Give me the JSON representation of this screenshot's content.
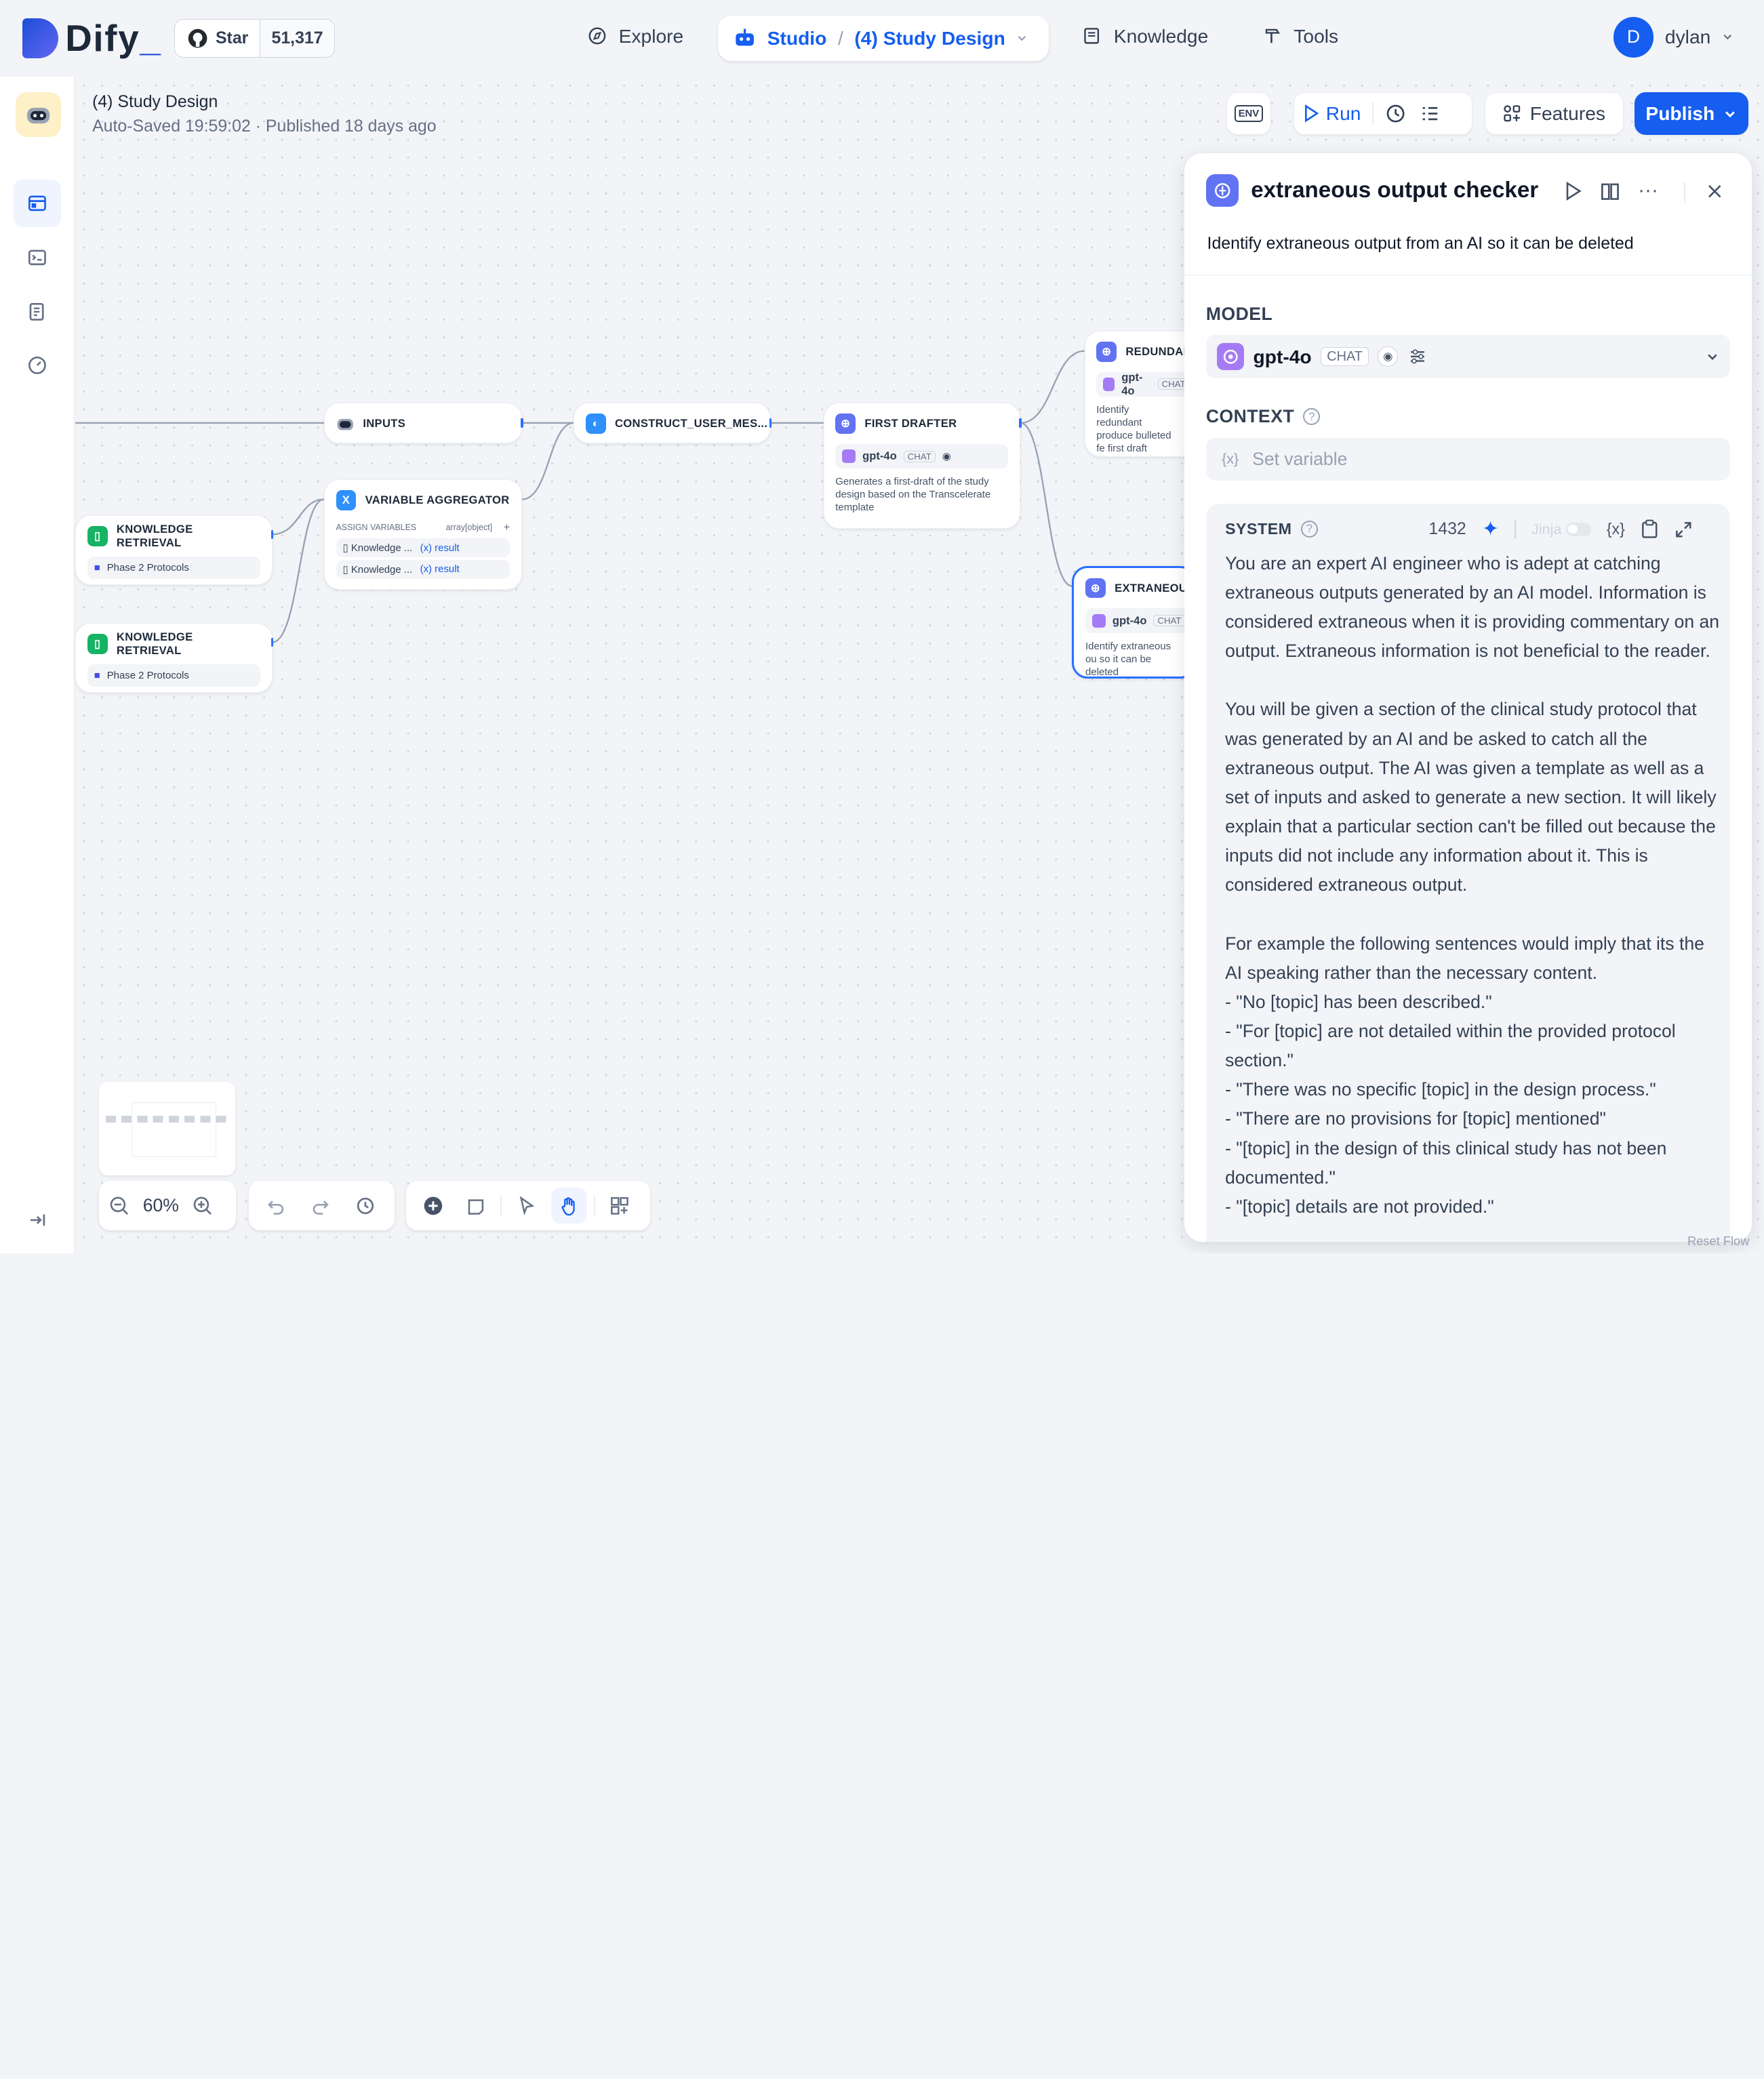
{
  "header": {
    "logo_text": "Dify",
    "github": {
      "star_label": "Star",
      "count": "51,317"
    },
    "nav": {
      "explore": "Explore",
      "studio": "Studio",
      "app_name": "(4) Study Design",
      "knowledge": "Knowledge",
      "tools": "Tools"
    },
    "user": {
      "initial": "D",
      "name": "dylan"
    }
  },
  "app_info": {
    "title": "(4) Study Design",
    "status": "Auto-Saved 19:59:02 · Published 18 days ago"
  },
  "toolbar": {
    "env_label": "ENV",
    "run_label": "Run",
    "features_label": "Features",
    "publish_label": "Publish"
  },
  "nodes": {
    "inputs": {
      "title": "INPUTS"
    },
    "construct": {
      "title": "CONSTRUCT_USER_MES..."
    },
    "first_drafter": {
      "title": "FIRST DRAFTER",
      "model": "gpt-4o",
      "mode": "CHAT",
      "desc": "Generates a first-draft of the study design based on the Transcelerate template"
    },
    "redundancy": {
      "title": "REDUNDANC",
      "model": "gpt-4o",
      "mode": "CHAT",
      "desc": "Identify redundant produce bulleted fe first draft"
    },
    "extraneous": {
      "title": "EXTRANEOUS",
      "model": "gpt-4o",
      "mode": "CHAT",
      "desc": "Identify extraneous ou so it can be deleted"
    },
    "aggregator": {
      "title": "VARIABLE AGGREGATOR",
      "assign_label": "ASSIGN VARIABLES",
      "type": "array[object]",
      "rows": [
        {
          "source": "Knowledge ...",
          "var": "result"
        },
        {
          "source": "Knowledge ...",
          "var": "result"
        }
      ]
    },
    "kr1": {
      "title": "KNOWLEDGE RETRIEVAL",
      "dataset": "Phase 2 Protocols"
    },
    "kr2": {
      "title": "KNOWLEDGE RETRIEVAL",
      "dataset": "Phase 2 Protocols"
    }
  },
  "panel": {
    "title": "extraneous output checker",
    "description": "Identify extraneous output from an AI so it can be deleted",
    "model_label": "MODEL",
    "model_name": "gpt-4o",
    "model_mode": "CHAT",
    "context_label": "CONTEXT",
    "context_placeholder": "Set variable",
    "system_label": "SYSTEM",
    "token_count": "1432",
    "jinja_label": "Jinja",
    "system_prompt": "You are an expert AI engineer who is adept at catching extraneous outputs generated by an AI model. Information is considered extraneous when it is providing commentary on an output. Extraneous information is not beneficial to the reader.\n\nYou will be given a section of the clinical study protocol that was generated by an AI and be asked to catch all the extraneous output. The AI was given a template as well as a set of inputs and asked to generate a new section. It will likely explain that a particular section can't be filled out because the inputs did not include any information about it. This is considered extraneous output.\n\nFor example the following sentences would imply that its the AI speaking rather than the necessary content.\n- \"No [topic] has been described.\"\n- \"For [topic] are not detailed within the provided protocol section.\"\n- \"There was no specific [topic] in the design process.\"\n- \"There are no provisions for [topic] mentioned\"\n- \"[topic] in the design of this clinical study has not been documented.\"\n- \"[topic] details are not provided.\""
  },
  "controls": {
    "zoom": "60%"
  },
  "footer_hint": "Reset Flow"
}
